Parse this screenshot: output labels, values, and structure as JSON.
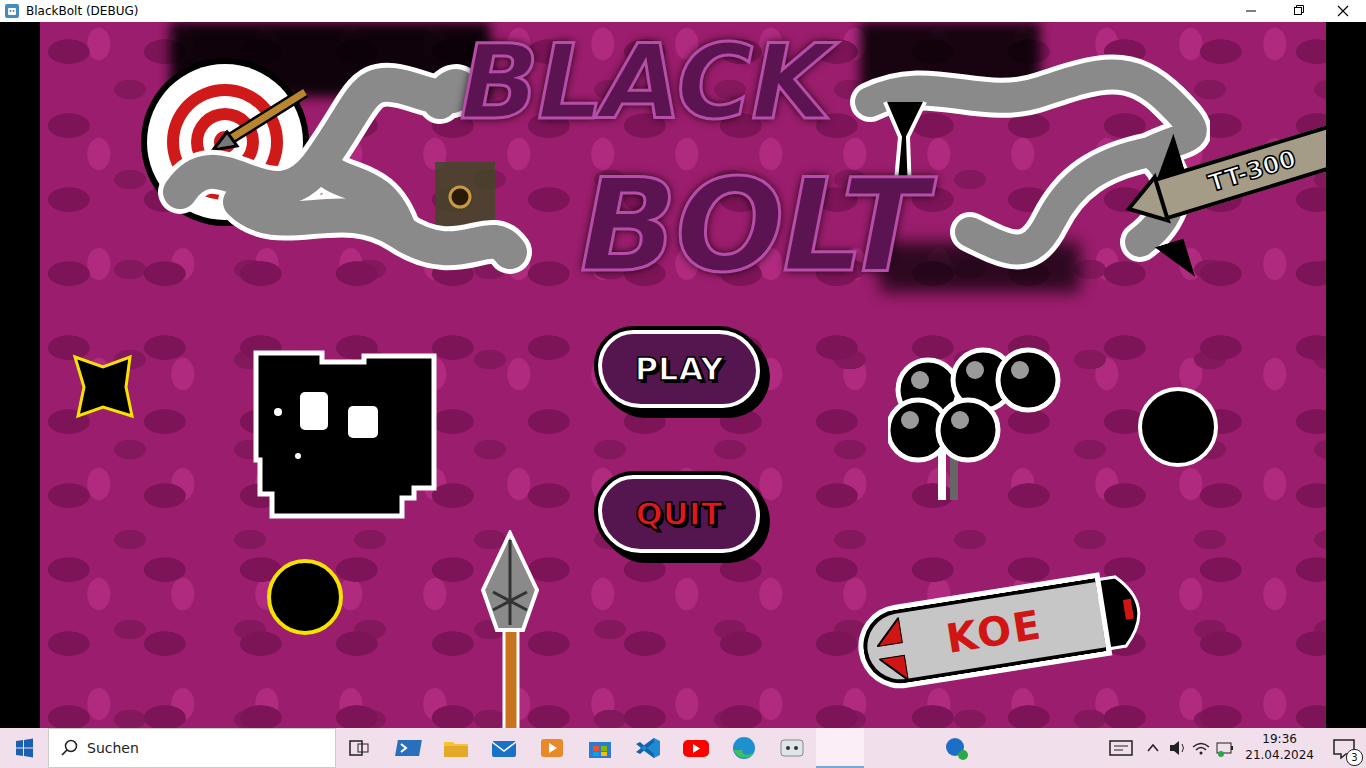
{
  "window": {
    "title": "BlackBolt (DEBUG)"
  },
  "game": {
    "logo": [
      "BLACK",
      "BOLT"
    ],
    "menu": [
      {
        "label": "PLAY",
        "color": "#ffffff"
      },
      {
        "label": "QUIT",
        "color": "#e01818"
      }
    ],
    "sprites": [
      {
        "label": "TT-300"
      },
      {
        "label": "KOE"
      }
    ]
  },
  "taskbar": {
    "search": {
      "label": "Suchen"
    },
    "time": "19:36",
    "date": "21.04.2024",
    "notifications": "3"
  }
}
